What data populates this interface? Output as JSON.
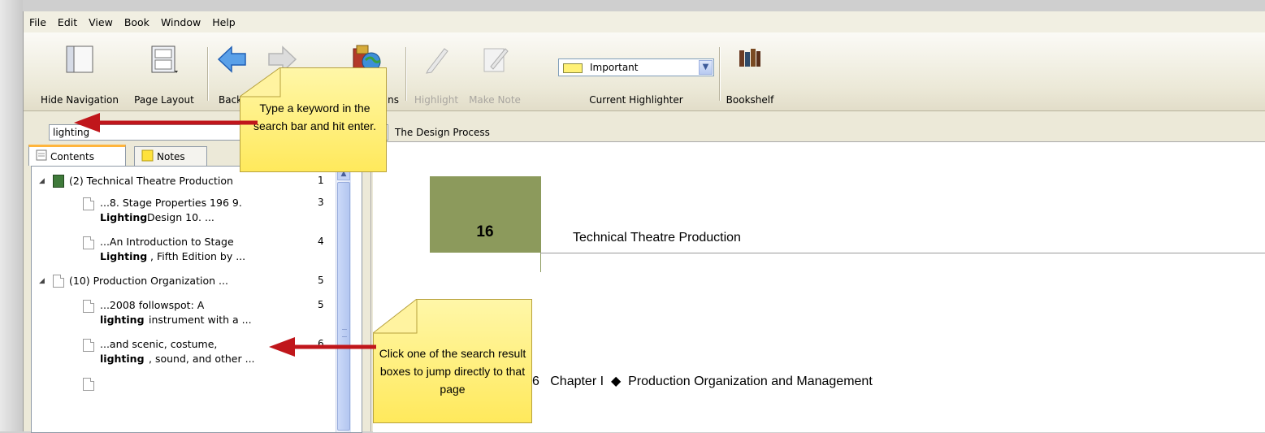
{
  "menu": [
    "File",
    "Edit",
    "View",
    "Book",
    "Window",
    "Help"
  ],
  "toolbar": {
    "hide_navigation": "Hide Navigation",
    "page_layout": "Page Layout",
    "back": "Back",
    "forward_partial": "ns",
    "highlight": "Highlight",
    "make_note": "Make Note",
    "current_highlighter": "Current Highlighter",
    "highlighter_value": "Important",
    "highlighter_color": "#fff176",
    "bookshelf": "Bookshelf"
  },
  "search": {
    "value": "lighting"
  },
  "tabs": {
    "contents": "Contents",
    "notes": "Notes"
  },
  "tree": {
    "group1": {
      "label": "(2) Technical Theatre Production",
      "page": "1"
    },
    "item1": {
      "line1": "...8. Stage Properties 196 9.",
      "bold": "Lighting",
      "rest": " Design 10. ...",
      "page": "3"
    },
    "item2": {
      "line1": "...An Introduction to Stage",
      "bold": "Lighting",
      "rest": ", Fifth Edition by ...",
      "page": "4"
    },
    "group2": {
      "label": "(10) Production Organization ...",
      "page": "5"
    },
    "item3": {
      "line1": "...2008 followspot: A",
      "bold": "lighting",
      "rest": " instrument with a ...",
      "page": "5"
    },
    "item4": {
      "line1": "...and scenic, costume,",
      "bold": "lighting",
      "rest": ", sound, and other ...",
      "page": "6"
    }
  },
  "breadcrumb": "The Design Process",
  "document": {
    "folio": "16",
    "running_head": "Technical Theatre Production",
    "chapter_line": "6   Chapter I  ◆  Production Organization and Management"
  },
  "callouts": {
    "search_tip": "Type a keyword in the search bar and hit enter.",
    "result_tip": "Click one of the search result boxes to jump directly to that page"
  }
}
